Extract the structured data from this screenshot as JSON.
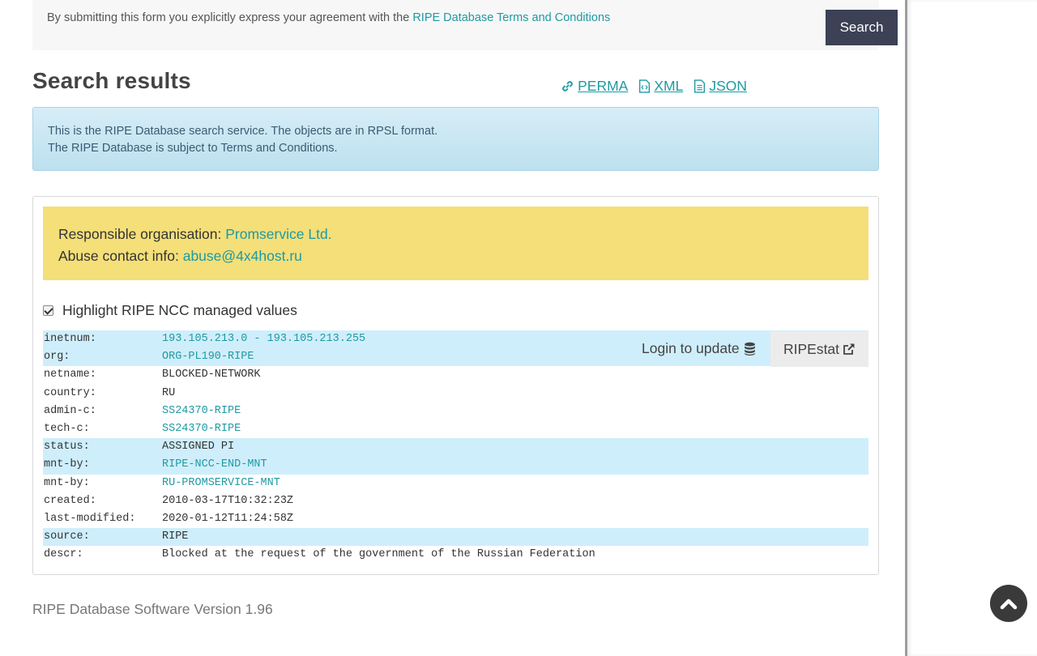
{
  "form": {
    "agreement_text": "By submitting this form you explicitly express your agreement with the ",
    "terms_link": "RIPE Database Terms and Conditions",
    "search_label": "Search"
  },
  "results": {
    "title": "Search results",
    "exports": [
      {
        "label": "PERMA",
        "icon": "link-icon"
      },
      {
        "label": "XML",
        "icon": "code-file-icon"
      },
      {
        "label": "JSON",
        "icon": "text-file-icon"
      }
    ],
    "info_line1": "This is the RIPE Database search service. The objects are in RPSL format.",
    "info_line2": "The RIPE Database is subject to Terms and Conditions."
  },
  "org_box": {
    "responsible_label": "Responsible organisation: ",
    "responsible_value": "Promservice Ltd.",
    "abuse_label": "Abuse contact info: ",
    "abuse_value": "abuse@4x4host.ru"
  },
  "highlight": {
    "label": "Highlight RIPE NCC managed values",
    "checked": true
  },
  "object": {
    "login_label": "Login to update",
    "ripestat_label": "RIPEstat",
    "rows": [
      {
        "attr": "inetnum:",
        "value": "193.105.213.0 - 193.105.213.255",
        "ref": true,
        "managed": true
      },
      {
        "attr": "org:",
        "value": "ORG-PL190-RIPE",
        "ref": true,
        "managed": true
      },
      {
        "attr": "netname:",
        "value": "BLOCKED-NETWORK",
        "ref": false,
        "managed": false
      },
      {
        "attr": "country:",
        "value": "RU",
        "ref": false,
        "managed": false
      },
      {
        "attr": "admin-c:",
        "value": "SS24370-RIPE",
        "ref": true,
        "managed": false
      },
      {
        "attr": "tech-c:",
        "value": "SS24370-RIPE",
        "ref": true,
        "managed": false
      },
      {
        "attr": "status:",
        "value": "ASSIGNED PI",
        "ref": false,
        "managed": true
      },
      {
        "attr": "mnt-by:",
        "value": "RIPE-NCC-END-MNT",
        "ref": true,
        "managed": true
      },
      {
        "attr": "mnt-by:",
        "value": "RU-PROMSERVICE-MNT",
        "ref": true,
        "managed": false
      },
      {
        "attr": "created:",
        "value": "2010-03-17T10:32:23Z",
        "ref": false,
        "managed": false
      },
      {
        "attr": "last-modified:",
        "value": "2020-01-12T11:24:58Z",
        "ref": false,
        "managed": false
      },
      {
        "attr": "source:",
        "value": "RIPE",
        "ref": false,
        "managed": true
      },
      {
        "attr": "descr:",
        "value": "Blocked at the request of the government of the Russian Federation",
        "ref": false,
        "managed": false
      }
    ]
  },
  "footer": {
    "version": "RIPE Database Software Version 1.96"
  },
  "colors": {
    "link": "#1e9aa3",
    "managed_highlight": "#cfeefb",
    "org_box": "#f4df79",
    "search_button": "#3c4156"
  }
}
